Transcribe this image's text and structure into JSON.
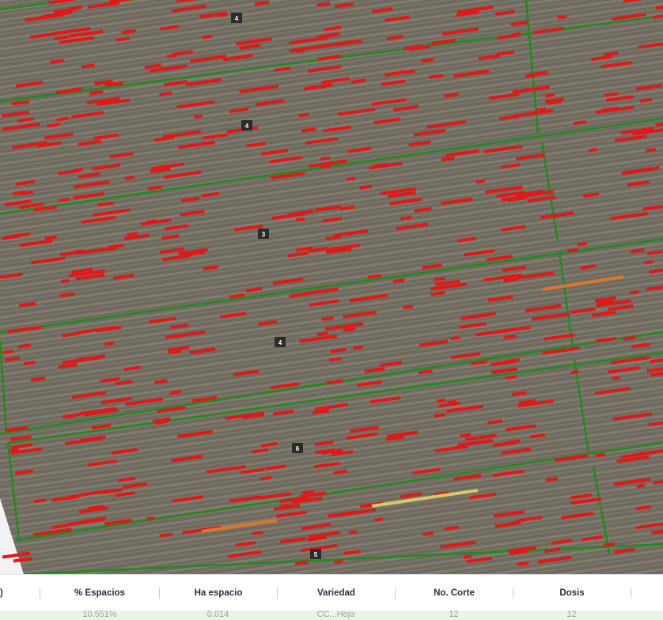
{
  "map": {
    "lot_labels": [
      {
        "id": "lot-label-4a",
        "text": "4"
      },
      {
        "id": "lot-label-4b",
        "text": "4"
      },
      {
        "id": "lot-label-3",
        "text": "3"
      },
      {
        "id": "lot-label-4c",
        "text": "4"
      },
      {
        "id": "lot-label-6",
        "text": "6"
      },
      {
        "id": "lot-label-5",
        "text": "5"
      }
    ],
    "colors": {
      "field": "#7a7468",
      "boundary": "#1f8a1f",
      "gap": "#e01818",
      "gap_long": "#d9772a",
      "gap_yellow": "#d8c86a"
    }
  },
  "table": {
    "headers": [
      ")",
      "% Espacios",
      "Ha espacio",
      "Variedad",
      "No. Corte",
      "Dosis"
    ],
    "first_row": [
      "",
      "10.551%",
      "0.014",
      "CC...Hoja",
      "12",
      "12"
    ]
  }
}
